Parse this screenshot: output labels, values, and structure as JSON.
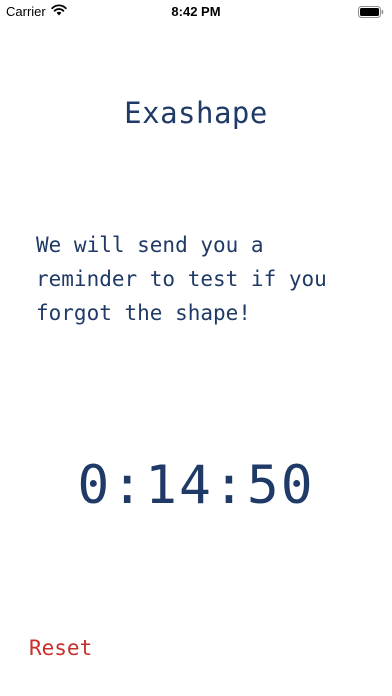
{
  "status_bar": {
    "carrier": "Carrier",
    "time": "8:42 PM",
    "wifi_icon": "wifi-icon",
    "battery_icon": "battery-icon"
  },
  "app": {
    "title": "Exashape",
    "message": "We will send you a reminder to test if you forgot the shape!",
    "timer": "0:14:50",
    "reset_label": "Reset"
  },
  "colors": {
    "text_primary": "#1f3a66",
    "reset": "#c9302c",
    "background": "#ffffff"
  }
}
